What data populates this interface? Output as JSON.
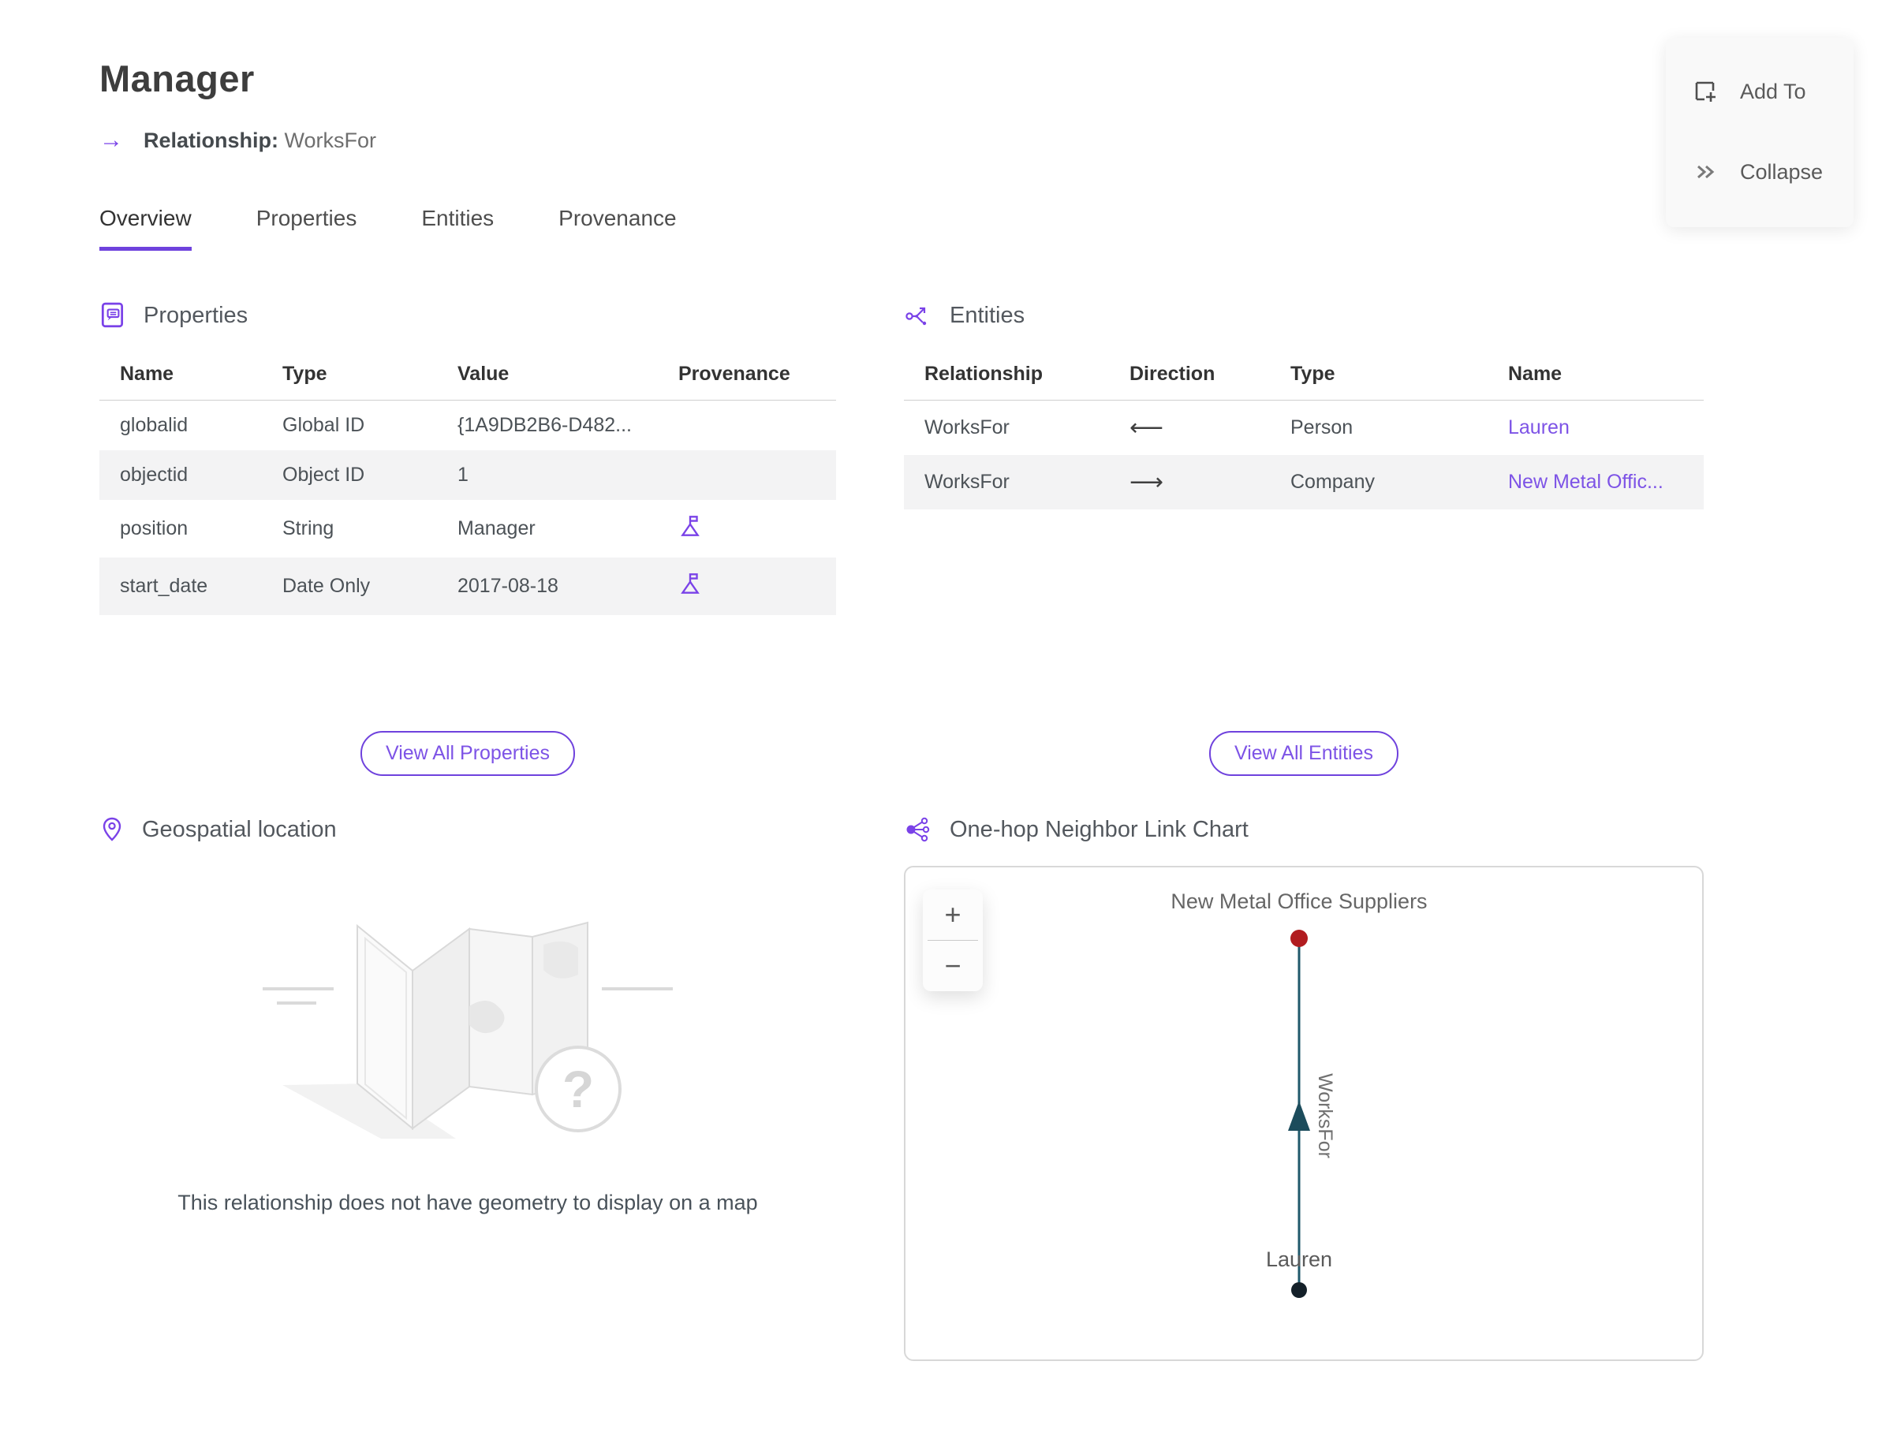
{
  "header": {
    "title": "Manager",
    "arrow_icon": "→",
    "relationship_label": "Relationship:",
    "relationship_value": "WorksFor"
  },
  "actions": {
    "add_to_label": "Add To",
    "collapse_label": "Collapse"
  },
  "tabs": {
    "overview": "Overview",
    "properties": "Properties",
    "entities": "Entities",
    "provenance": "Provenance",
    "active_tab": "Overview"
  },
  "properties_section": {
    "title": "Properties",
    "columns": {
      "name": "Name",
      "type": "Type",
      "value": "Value",
      "provenance": "Provenance"
    },
    "rows": [
      {
        "name": "globalid",
        "type": "Global ID",
        "value": "{1A9DB2B6-D482...",
        "provenance": ""
      },
      {
        "name": "objectid",
        "type": "Object ID",
        "value": "1",
        "provenance": ""
      },
      {
        "name": "position",
        "type": "String",
        "value": "Manager",
        "provenance": "flag"
      },
      {
        "name": "start_date",
        "type": "Date Only",
        "value": "2017-08-18",
        "provenance": "flag"
      }
    ],
    "view_all_label": "View All Properties"
  },
  "entities_section": {
    "title": "Entities",
    "columns": {
      "relationship": "Relationship",
      "direction": "Direction",
      "type": "Type",
      "name": "Name"
    },
    "rows": [
      {
        "relationship": "WorksFor",
        "direction": "⟵",
        "type": "Person",
        "name": "Lauren"
      },
      {
        "relationship": "WorksFor",
        "direction": "⟶",
        "type": "Company",
        "name": "New Metal Offic..."
      }
    ],
    "view_all_label": "View All Entities"
  },
  "geospatial_section": {
    "title": "Geospatial location",
    "empty_message": "This relationship does not have geometry to display on a map",
    "question_mark": "?"
  },
  "link_chart_section": {
    "title": "One-hop Neighbor Link Chart",
    "zoom_in_label": "+",
    "zoom_out_label": "−",
    "top_node_label": "New Metal Office Suppliers",
    "bottom_node_label": "Lauren",
    "edge_label": "WorksFor"
  },
  "colors": {
    "accent_purple": "#6f42dd",
    "link_purple": "#7d53e6",
    "icon_purple": "#7a42e8",
    "edge_teal": "#20596b",
    "node_red": "#b11c20",
    "node_dark": "#142029"
  }
}
